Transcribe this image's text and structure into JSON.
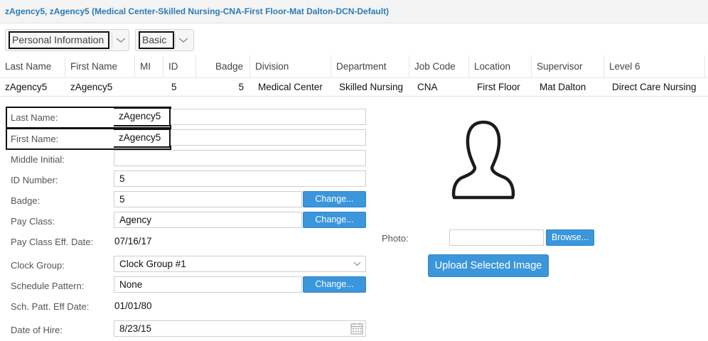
{
  "title": "zAgency5, zAgency5 (Medical Center-Skilled Nursing-CNA-First Floor-Mat Dalton-DCN-Default)",
  "dropdowns": {
    "section": "Personal Information",
    "view": "Basic"
  },
  "grid": {
    "headers": [
      "Last Name",
      "First Name",
      "MI",
      "ID",
      "Badge",
      "Division",
      "Department",
      "Job Code",
      "Location",
      "Supervisor",
      "Level 6"
    ],
    "row": [
      "zAgency5",
      "zAgency5",
      "",
      "5",
      "5",
      "Medical Center",
      "Skilled Nursing",
      "CNA",
      "First Floor",
      "Mat Dalton",
      "Direct Care Nursing"
    ]
  },
  "form": {
    "last_name": {
      "label": "Last Name:",
      "value": "zAgency5"
    },
    "first_name": {
      "label": "First Name:",
      "value": "zAgency5"
    },
    "middle_initial": {
      "label": "Middle Initial:",
      "value": ""
    },
    "id_number": {
      "label": "ID Number:",
      "value": "5"
    },
    "badge": {
      "label": "Badge:",
      "value": "5",
      "button": "Change..."
    },
    "pay_class": {
      "label": "Pay Class:",
      "value": "Agency",
      "button": "Change..."
    },
    "pay_class_eff_date": {
      "label": "Pay Class Eff. Date:",
      "value": "07/16/17"
    },
    "clock_group": {
      "label": "Clock Group:",
      "value": "Clock Group #1"
    },
    "schedule_pattern": {
      "label": "Schedule Pattern:",
      "value": "None",
      "button": "Change..."
    },
    "sch_patt_eff_date": {
      "label": "Sch. Patt. Eff Date:",
      "value": "01/01/80"
    },
    "date_of_hire": {
      "label": "Date of Hire:",
      "value": "8/23/15"
    }
  },
  "photo": {
    "label": "Photo:",
    "browse": "Browse...",
    "upload": "Upload Selected Image"
  },
  "icons": {
    "chevron": "chevron-down-icon",
    "avatar": "user-silhouette-icon",
    "calendar": "calendar-icon"
  },
  "colors": {
    "title": "#2a7ab8",
    "button": "#3b96db"
  }
}
